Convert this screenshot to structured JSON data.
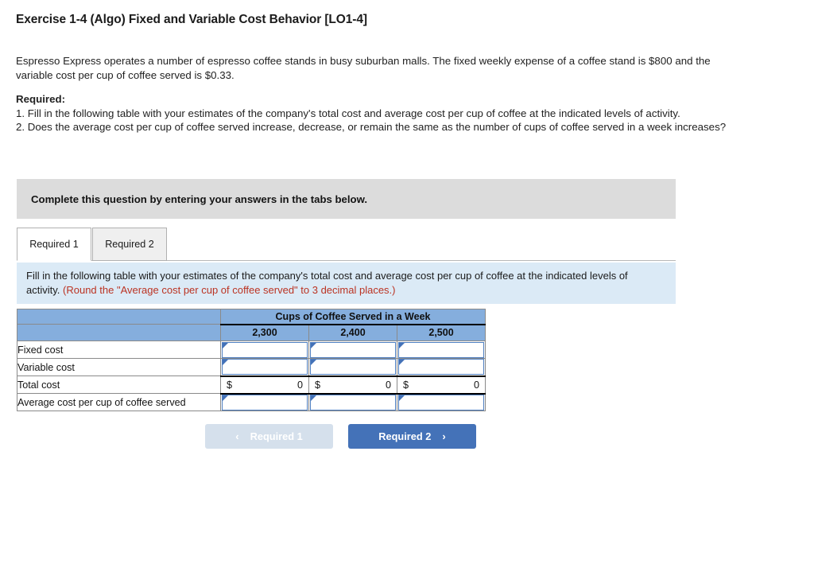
{
  "exercise": {
    "title": "Exercise 1-4 (Algo) Fixed and Variable Cost Behavior [LO1-4]",
    "paragraph": "Espresso Express operates a number of espresso coffee stands in busy suburban malls. The fixed weekly expense of a coffee stand is $800 and the variable cost per cup of coffee served is $0.33.",
    "required_label": "Required:",
    "requirement_1": "1. Fill in the following table with your estimates of the company's total cost and average cost per cup of coffee at the indicated levels of activity.",
    "requirement_2": "2. Does the average cost per cup of coffee served increase, decrease, or remain the same as the number of cups of coffee served in a week increases?"
  },
  "instruction_band": {
    "text": "Complete this question by entering your answers in the tabs below."
  },
  "tabs": [
    {
      "label": "Required 1",
      "active": true
    },
    {
      "label": "Required 2",
      "active": false
    }
  ],
  "tab_instruction": {
    "main": "Fill in the following table with your estimates of the company's total cost and average cost per cup of coffee at the indicated levels of activity.",
    "note": "(Round the \"Average cost per cup of coffee served\" to 3 decimal places.)"
  },
  "table": {
    "group_header": "Cups of Coffee Served in a Week",
    "column_headers": [
      "2,300",
      "2,400",
      "2,500"
    ],
    "rows": [
      {
        "label": "Fixed cost",
        "type": "input",
        "values": [
          "",
          "",
          ""
        ]
      },
      {
        "label": "Variable cost",
        "type": "input",
        "values": [
          "",
          "",
          ""
        ]
      },
      {
        "label": "Total cost",
        "type": "total",
        "currency": "$",
        "values": [
          "0",
          "0",
          "0"
        ]
      },
      {
        "label": "Average cost per cup of coffee served",
        "type": "input",
        "values": [
          "",
          "",
          ""
        ]
      }
    ]
  },
  "nav": {
    "prev_label": "Required 1",
    "next_label": "Required 2",
    "prev_icon": "chevron-left-icon",
    "next_icon": "chevron-right-icon",
    "prev_chevron": "‹",
    "next_chevron": "›"
  },
  "colors": {
    "table_header_blue": "#85aedd",
    "instruction_gray": "#dcdcdc",
    "instruction_blue": "#dbeaf6",
    "note_red": "#bb3322",
    "button_active_blue": "#4472b8",
    "button_disabled": "#d5e0ec",
    "input_border_blue": "#4f7fc0"
  }
}
